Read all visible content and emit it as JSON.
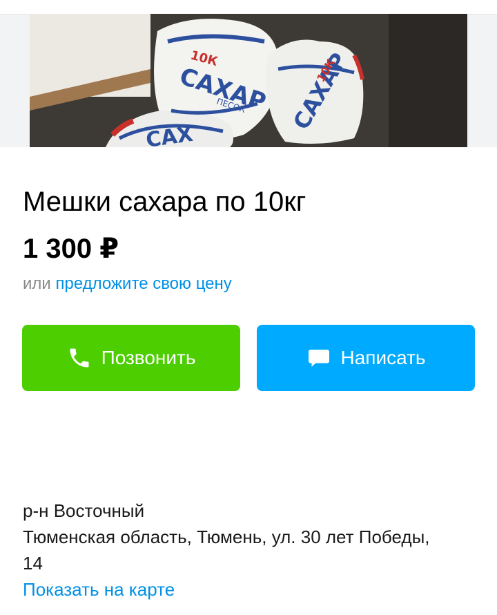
{
  "listing": {
    "title": "Мешки сахара по 10кг",
    "price": "1 300 ₽",
    "offer_prefix": "или ",
    "offer_link": "предложите свою цену"
  },
  "photo": {
    "bag_print": [
      "10К",
      "САХАР",
      "ПЕСОК"
    ]
  },
  "actions": {
    "call_label": "Позвонить",
    "call_icon": "phone-icon",
    "write_label": "Написать",
    "write_icon": "chat-bubble-icon"
  },
  "location": {
    "district": "р-н Восточный",
    "address_line1": "Тюменская область, Тюмень, ул. 30 лет Победы,",
    "address_line2": "14",
    "map_link": "Показать на карте"
  },
  "colors": {
    "call_button": "#4cce00",
    "write_button": "#00aaff",
    "link": "#0091e5",
    "muted_text": "#8a8a8a"
  }
}
